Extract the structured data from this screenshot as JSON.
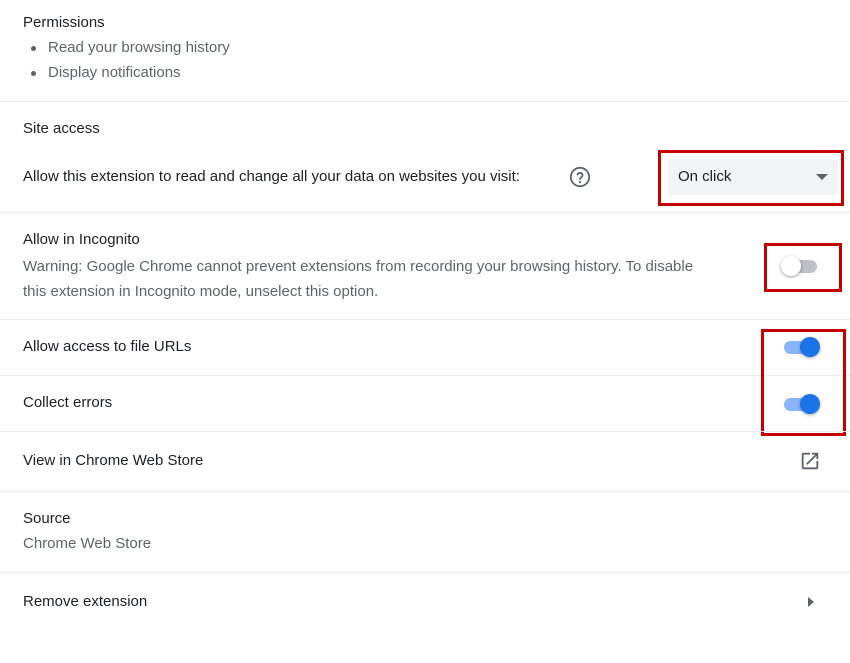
{
  "permissions": {
    "title": "Permissions",
    "items": [
      {
        "label": "Read your browsing history"
      },
      {
        "label": "Display notifications"
      }
    ]
  },
  "site_access": {
    "title": "Site access",
    "prompt": "Allow this extension to read and change all your data on websites you visit:",
    "help_icon": "help-circle-icon",
    "dropdown": {
      "selected": "On click"
    }
  },
  "incognito": {
    "title": "Allow in Incognito",
    "warning_line1": "Warning: Google Chrome cannot prevent extensions from recording your browsing history. To disable",
    "warning_line2": "this extension in Incognito mode, unselect this option.",
    "enabled": false
  },
  "file_urls": {
    "label": "Allow access to file URLs",
    "enabled": true
  },
  "collect_errors": {
    "label": "Collect errors",
    "enabled": true
  },
  "web_store": {
    "label": "View in Chrome Web Store",
    "icon": "open-in-new-icon"
  },
  "source": {
    "title": "Source",
    "value": "Chrome Web Store"
  },
  "remove": {
    "label": "Remove extension",
    "icon": "chevron-right-icon"
  },
  "colors": {
    "accent": "#1a73e8",
    "toggle_track_on": "#8ab4f8",
    "toggle_track_off": "#bdc1c6",
    "highlight_box": "#c40000",
    "divider": "#e8eaed"
  }
}
